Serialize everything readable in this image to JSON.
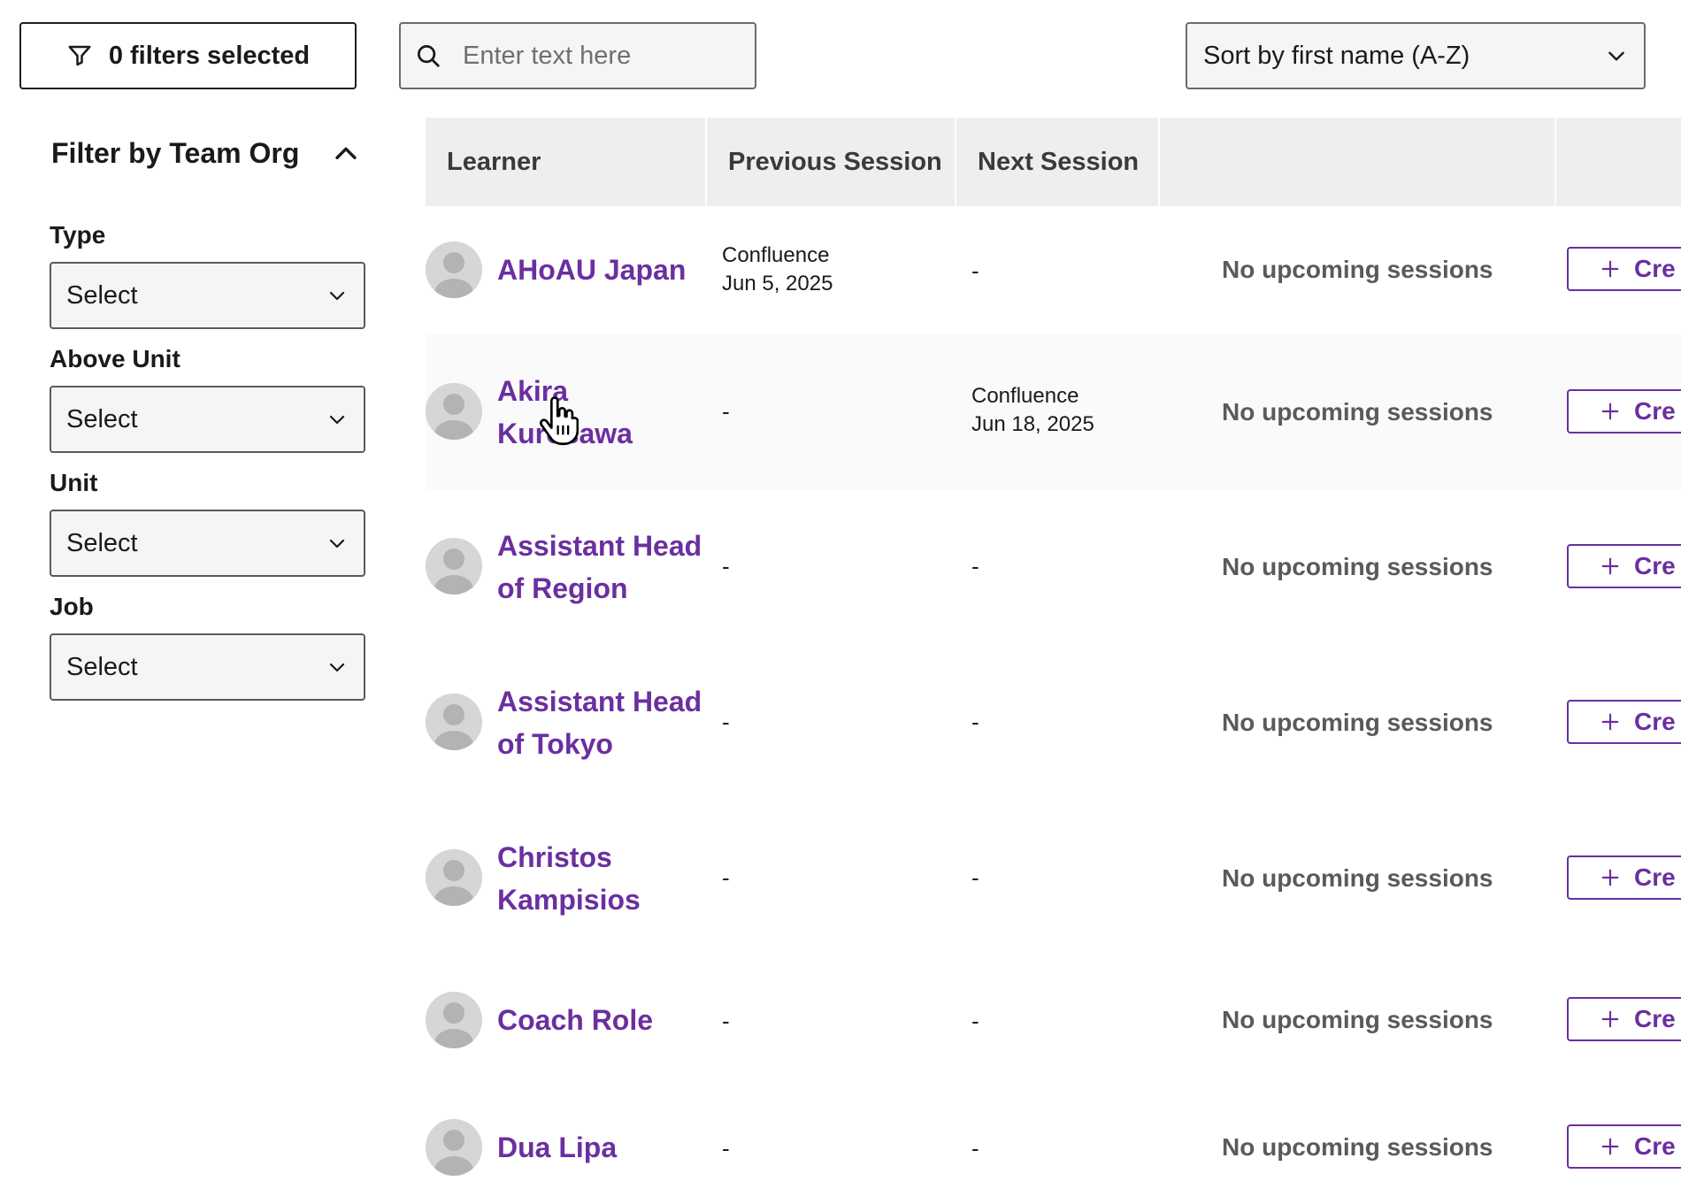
{
  "toolbar": {
    "filters_label": "0 filters selected",
    "search_placeholder": "Enter text here",
    "sort_label": "Sort by first name (A-Z)"
  },
  "sidebar": {
    "heading": "Filter by Team Org",
    "fields": [
      {
        "label": "Type",
        "value": "Select"
      },
      {
        "label": "Above Unit",
        "value": "Select"
      },
      {
        "label": "Unit",
        "value": "Select"
      },
      {
        "label": "Job",
        "value": "Select"
      }
    ]
  },
  "table": {
    "headers": {
      "learner": "Learner",
      "previous": "Previous Session",
      "next": "Next Session"
    },
    "rows": [
      {
        "name_line1": "AHoAU Japan",
        "name_line2": "",
        "prev_title": "Confluence",
        "prev_date": "Jun 5, 2025",
        "next": "-",
        "next_title": "",
        "next_date": "",
        "status": "No upcoming sessions",
        "action": "Cre"
      },
      {
        "name_line1": "Akira",
        "name_line2": "Kurosawa",
        "prev": "-",
        "next_title": "Confluence",
        "next_date": "Jun 18, 2025",
        "status": "No upcoming sessions",
        "action": "Cre"
      },
      {
        "name_line1": "Assistant Head",
        "name_line2": "of Region",
        "prev": "-",
        "next": "-",
        "status": "No upcoming sessions",
        "action": "Cre"
      },
      {
        "name_line1": "Assistant Head",
        "name_line2": "of Tokyo",
        "prev": "-",
        "next": "-",
        "status": "No upcoming sessions",
        "action": "Cre"
      },
      {
        "name_line1": "Christos",
        "name_line2": "Kampisios",
        "prev": "-",
        "next": "-",
        "status": "No upcoming sessions",
        "action": "Cre"
      },
      {
        "name_line1": "Coach Role",
        "name_line2": "",
        "prev": "-",
        "next": "-",
        "status": "No upcoming sessions",
        "action": "Cre"
      },
      {
        "name_line1": "Dua Lipa",
        "name_line2": "",
        "prev": "-",
        "next": "-",
        "status": "No upcoming sessions",
        "action": "Cre"
      }
    ]
  },
  "colors": {
    "accent": "#6b2fa0",
    "header_bg": "#eeeeee",
    "status_text": "#5a5a5a"
  }
}
